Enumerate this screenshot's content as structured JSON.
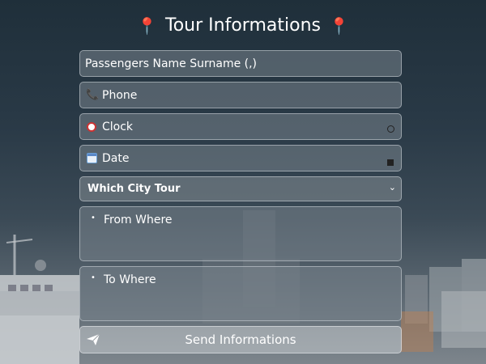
{
  "header": {
    "title": "Tour Informations",
    "pin_icon": "📍"
  },
  "form": {
    "passengers_placeholder": "Passengers Name Surname (,)",
    "phone_placeholder": "Phone",
    "phone_icon": "📞",
    "clock_placeholder": "Clock",
    "date_placeholder": "Date",
    "city_tour_select": "Which City Tour",
    "from_where_placeholder": "From Where",
    "to_where_placeholder": "To Where",
    "bullet": "•",
    "send_label": "Send Informations"
  },
  "colors": {
    "accent_pin": "#e8457a",
    "field_bg": "#78848c"
  }
}
